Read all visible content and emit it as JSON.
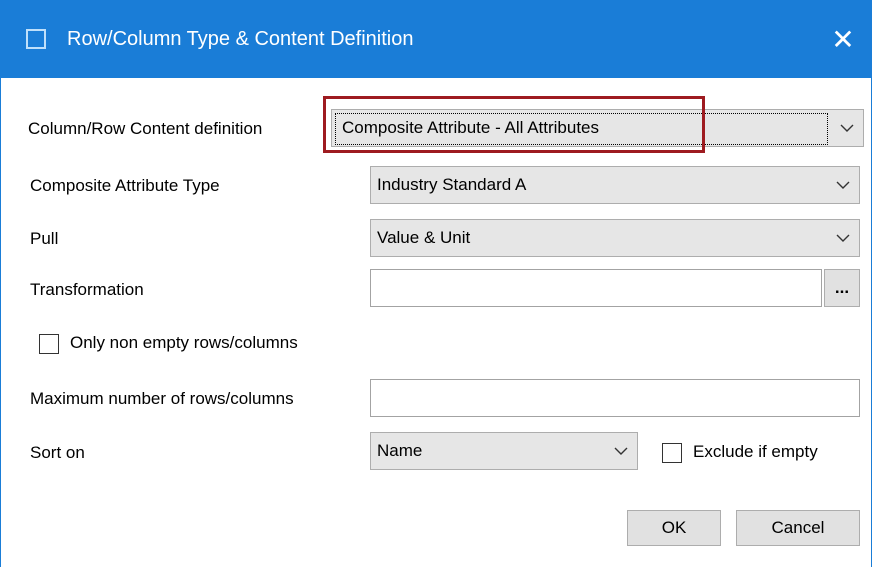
{
  "window": {
    "title": "Row/Column Type & Content Definition",
    "close_glyph": "✕",
    "accent_color": "#1a7dd7",
    "highlight_color": "#9e1b20"
  },
  "content_definition": {
    "label": "Column/Row Content definition",
    "value": "Composite Attribute - All Attributes"
  },
  "composite_attribute_type": {
    "label": "Composite Attribute Type",
    "value": "Industry Standard A"
  },
  "pull": {
    "label": "Pull",
    "value": "Value & Unit"
  },
  "transformation": {
    "label": "Transformation",
    "value": "",
    "browse_label": "..."
  },
  "only_non_empty": {
    "label": "Only non empty rows/columns",
    "checked": false
  },
  "max_rows": {
    "label": "Maximum number of rows/columns",
    "value": ""
  },
  "sort_on": {
    "label": "Sort on",
    "value": "Name"
  },
  "exclude_if_empty": {
    "label": "Exclude if empty",
    "checked": false
  },
  "buttons": {
    "ok": "OK",
    "cancel": "Cancel"
  }
}
